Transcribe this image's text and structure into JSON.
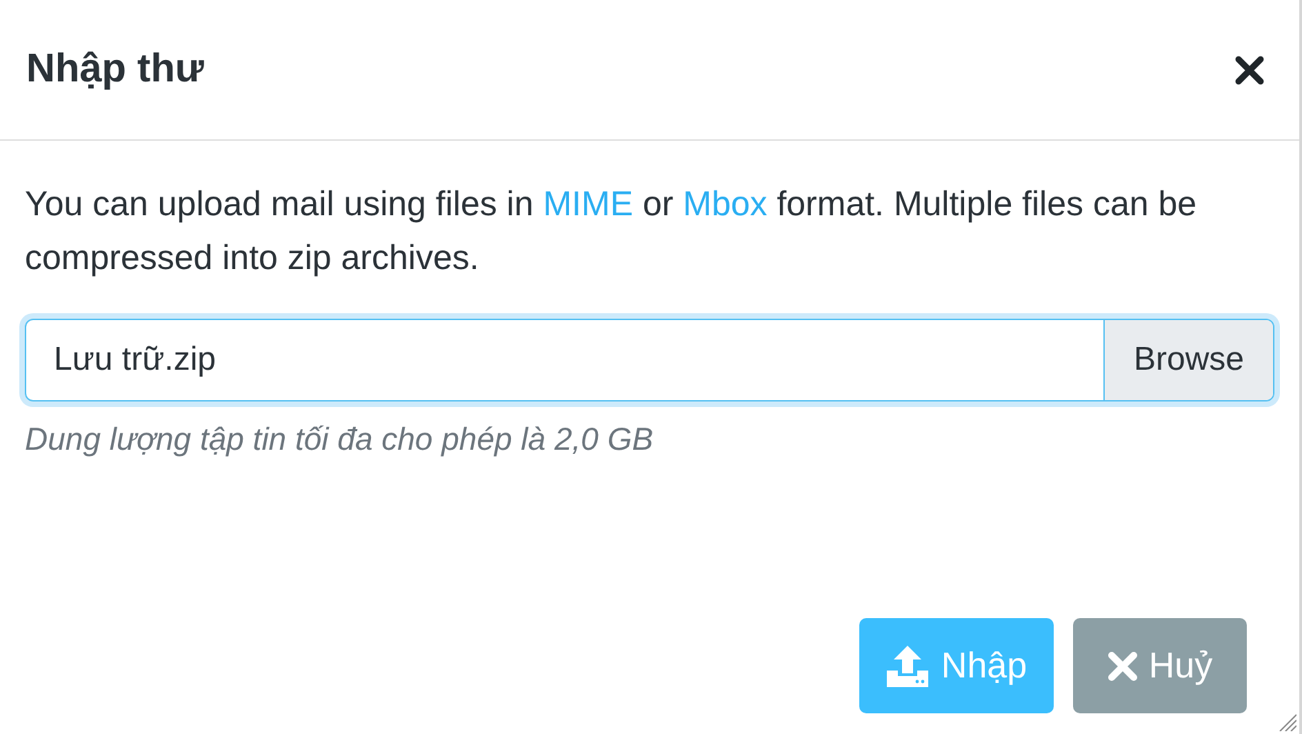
{
  "dialog": {
    "title": "Nhập thư",
    "description": [
      {
        "kind": "text",
        "text": "You can upload mail using files in "
      },
      {
        "kind": "link",
        "text": "MIME"
      },
      {
        "kind": "text",
        "text": " or "
      },
      {
        "kind": "link",
        "text": "Mbox"
      },
      {
        "kind": "text",
        "text": " format. Multiple files can be compressed into zip archives."
      }
    ],
    "file_field": {
      "value": "Lưu trữ.zip",
      "focused": true,
      "button": "Browse"
    },
    "hint": "Dung lượng tập tin tối đa cho phép là 2,0 GB",
    "buttons": [
      {
        "kind": "primary",
        "label": "Nhập"
      },
      {
        "kind": "cancel",
        "label": "Huỷ"
      }
    ]
  }
}
